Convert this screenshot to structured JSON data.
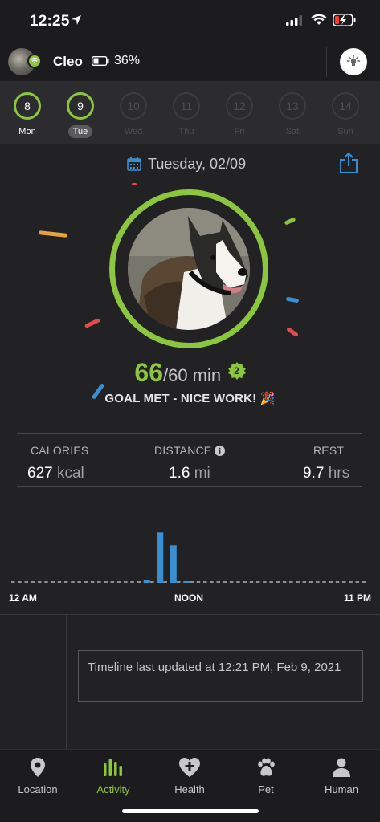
{
  "status_bar": {
    "time": "12:25"
  },
  "header": {
    "pet_name": "Cleo",
    "battery": "36%"
  },
  "days": [
    {
      "num": "8",
      "label": "Mon",
      "state": "active"
    },
    {
      "num": "9",
      "label": "Tue",
      "state": "selected"
    },
    {
      "num": "10",
      "label": "Wed",
      "state": "future"
    },
    {
      "num": "11",
      "label": "Thu",
      "state": "future"
    },
    {
      "num": "12",
      "label": "Fri",
      "state": "future"
    },
    {
      "num": "13",
      "label": "Sat",
      "state": "future"
    },
    {
      "num": "14",
      "label": "Sun",
      "state": "future"
    }
  ],
  "date_label": "Tuesday, 02/09",
  "goal": {
    "value": "66",
    "target": "/60 min",
    "streak": "2",
    "message": "GOAL MET - NICE WORK! 🎉"
  },
  "stats": {
    "calories": {
      "label": "CALORIES",
      "value": "627",
      "unit": "kcal"
    },
    "distance": {
      "label": "DISTANCE",
      "value": "1.6",
      "unit": "mi"
    },
    "rest": {
      "label": "REST",
      "value": "9.7",
      "unit": "hrs"
    }
  },
  "chart_data": {
    "type": "bar",
    "x_start": "12 AM",
    "x_mid": "NOON",
    "x_end": "11 PM",
    "bars": [
      {
        "slot": 20,
        "level": 0.05
      },
      {
        "slot": 22,
        "level": 0.98
      },
      {
        "slot": 24,
        "level": 0.73
      },
      {
        "slot": 26,
        "level": 0.03
      }
    ],
    "slots": 54
  },
  "timeline": {
    "message": "Timeline last updated at 12:21 PM, Feb 9, 2021"
  },
  "tabs": [
    {
      "label": "Location",
      "icon": "location-pin-icon"
    },
    {
      "label": "Activity",
      "icon": "activity-bars-icon",
      "active": true
    },
    {
      "label": "Health",
      "icon": "heart-plus-icon"
    },
    {
      "label": "Pet",
      "icon": "paw-icon"
    },
    {
      "label": "Human",
      "icon": "person-icon"
    }
  ],
  "colors": {
    "accent": "#8cc63f",
    "bar": "#3a8fd1",
    "background": "#222224"
  }
}
